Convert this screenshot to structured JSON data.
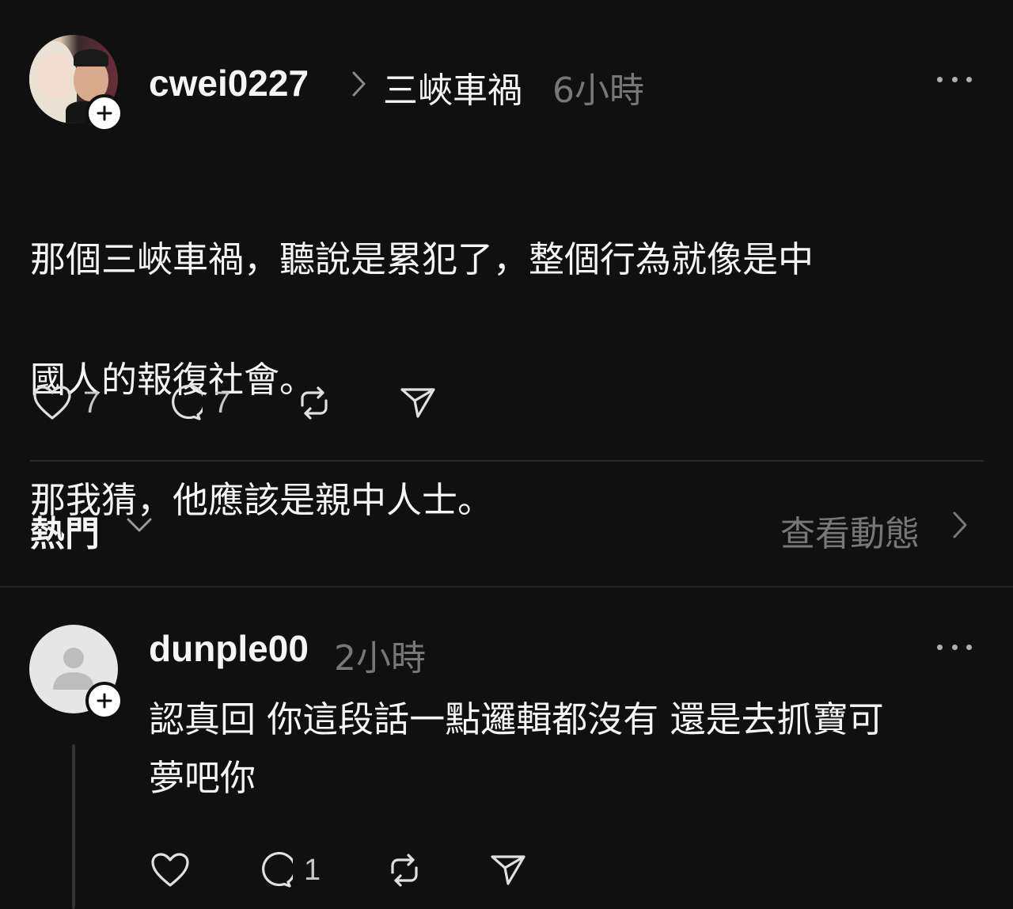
{
  "post": {
    "username": "cwei0227",
    "topic": "三峽車禍",
    "time": "6小時",
    "body_lines": [
      "那個三峽車禍，聽說是累犯了，整個行為就像是中",
      "國人的報復社會。",
      "那我猜，他應該是親中人士。"
    ],
    "likes": "7",
    "replies": "7"
  },
  "sort": {
    "label": "熱門",
    "activity_link": "查看動態"
  },
  "reply": {
    "username": "dunple00",
    "time": "2小時",
    "body_lines": [
      "認真回 你這段話一點邏輯都沒有 還是去抓寶可",
      "夢吧你"
    ],
    "replies": "1"
  },
  "icons": {
    "like": "heart-icon",
    "reply": "comment-icon",
    "repost": "repost-icon",
    "share": "send-icon",
    "more": "more-icon",
    "follow": "plus-icon"
  },
  "colors": {
    "background": "#101010",
    "text": "#f3f5f7",
    "secondary": "#777777"
  }
}
